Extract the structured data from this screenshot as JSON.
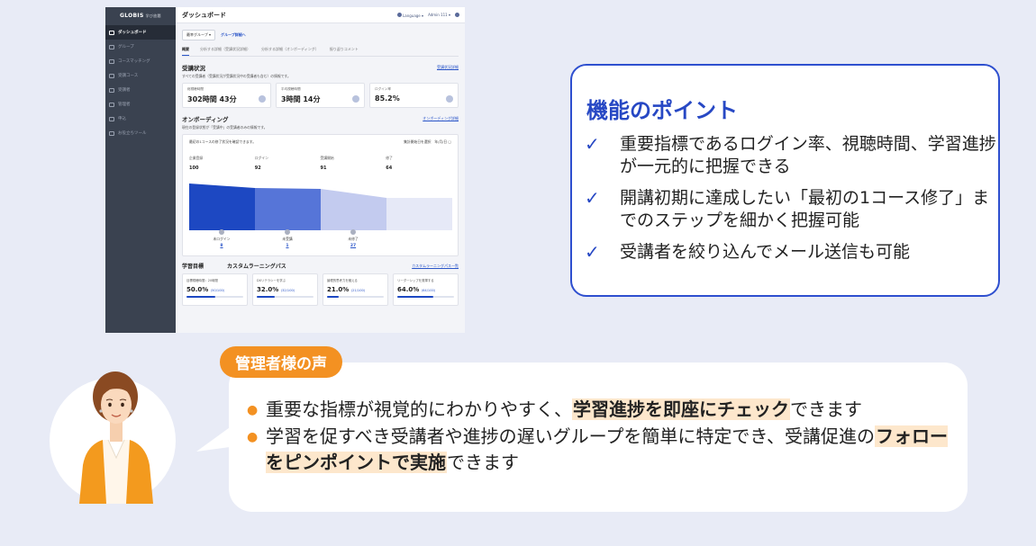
{
  "app": {
    "brand": "GLOBIS",
    "brand_sub": "学び放題",
    "page_title": "ダッシュボード",
    "top_right": {
      "language": "Language",
      "user": "Admin 111"
    },
    "sidebar_items": [
      "ダッシュボード",
      "グループ",
      "コースマッチング",
      "受講コース",
      "受講者",
      "管理者",
      "申込",
      "お役立ちツール"
    ],
    "group_select": "最幸グループ",
    "group_link": "グループ詳細へ",
    "tabs": [
      "概要",
      "分析する詳細（受講状況詳細）",
      "分析する詳細（オンボーディング）",
      "振り返りコメント"
    ],
    "status": {
      "title": "受講状況",
      "link": "受講状況詳細",
      "desc": "すべての受講者（受講状況が受講状況中の受講者も含む）の情報です。",
      "kpis": [
        {
          "label": "総視聴時間",
          "value": "302時間 43分"
        },
        {
          "label": "平均視聴時間",
          "value": "3時間 14分"
        },
        {
          "label": "ログイン率",
          "value": "85.2%"
        }
      ]
    },
    "onboarding": {
      "title": "オンボーディング",
      "link": "オンボーディング詳細",
      "desc": "現在の登録状態が「受講中」の受講者のみの情報です。",
      "box_title": "最初の1コースの修了状況を確認できます。",
      "date_label": "集計開始日を選択",
      "date_value": "年/月/日",
      "stages": [
        {
          "label": "企業登録",
          "value": "100"
        },
        {
          "label": "ログイン",
          "value": "92"
        },
        {
          "label": "受講開始",
          "value": "91"
        },
        {
          "label": "修了",
          "value": "64"
        }
      ],
      "dropoffs": [
        {
          "label": "未ログイン",
          "value": "8"
        },
        {
          "label": "未受講",
          "value": "1"
        },
        {
          "label": "未修了",
          "value": "27"
        }
      ]
    },
    "goals": {
      "title": "学習目標",
      "custom_title": "カスタムラーニングパス",
      "custom_link": "カスタムラーニングパス一覧",
      "cards": [
        {
          "label": "目標視聴時間：20時間",
          "pct": "50.0%",
          "sub": "(50/100)",
          "progress": 0.5
        },
        {
          "label": "DXリテラシーを学ぶ",
          "pct": "32.0%",
          "sub": "(32/100)",
          "progress": 0.32
        },
        {
          "label": "論理的思考力を鍛える",
          "pct": "21.0%",
          "sub": "(21/100)",
          "progress": 0.21
        },
        {
          "label": "リーダーシップを発揮する",
          "pct": "64.0%",
          "sub": "(64/100)",
          "progress": 0.64
        }
      ]
    }
  },
  "feature": {
    "title": "機能のポイント",
    "check_icon": "✓",
    "points": [
      "重要指標であるログイン率、視聴時間、学習進捗が一元的に把握できる",
      "開講初期に達成したい「最初の1コース修了」までのステップを細かく把握可能",
      "受講者を絞り込んでメール送信も可能"
    ]
  },
  "voice": {
    "title": "管理者様の声",
    "bullet": "●",
    "item1": {
      "pre": "重要な指標が視覚的にわかりやすく、",
      "hl": "学習進捗を即座にチェック",
      "post": "できます"
    },
    "item2": {
      "pre": "学習を促すべき受講者や進捗の遅いグループを簡単に特定でき、受講促進の",
      "hl": "フォローをピンポイントで実施",
      "post": "できます"
    }
  },
  "colors": {
    "accent_blue": "#2748c4",
    "accent_orange": "#f39122",
    "highlight": "#fde7cc"
  }
}
